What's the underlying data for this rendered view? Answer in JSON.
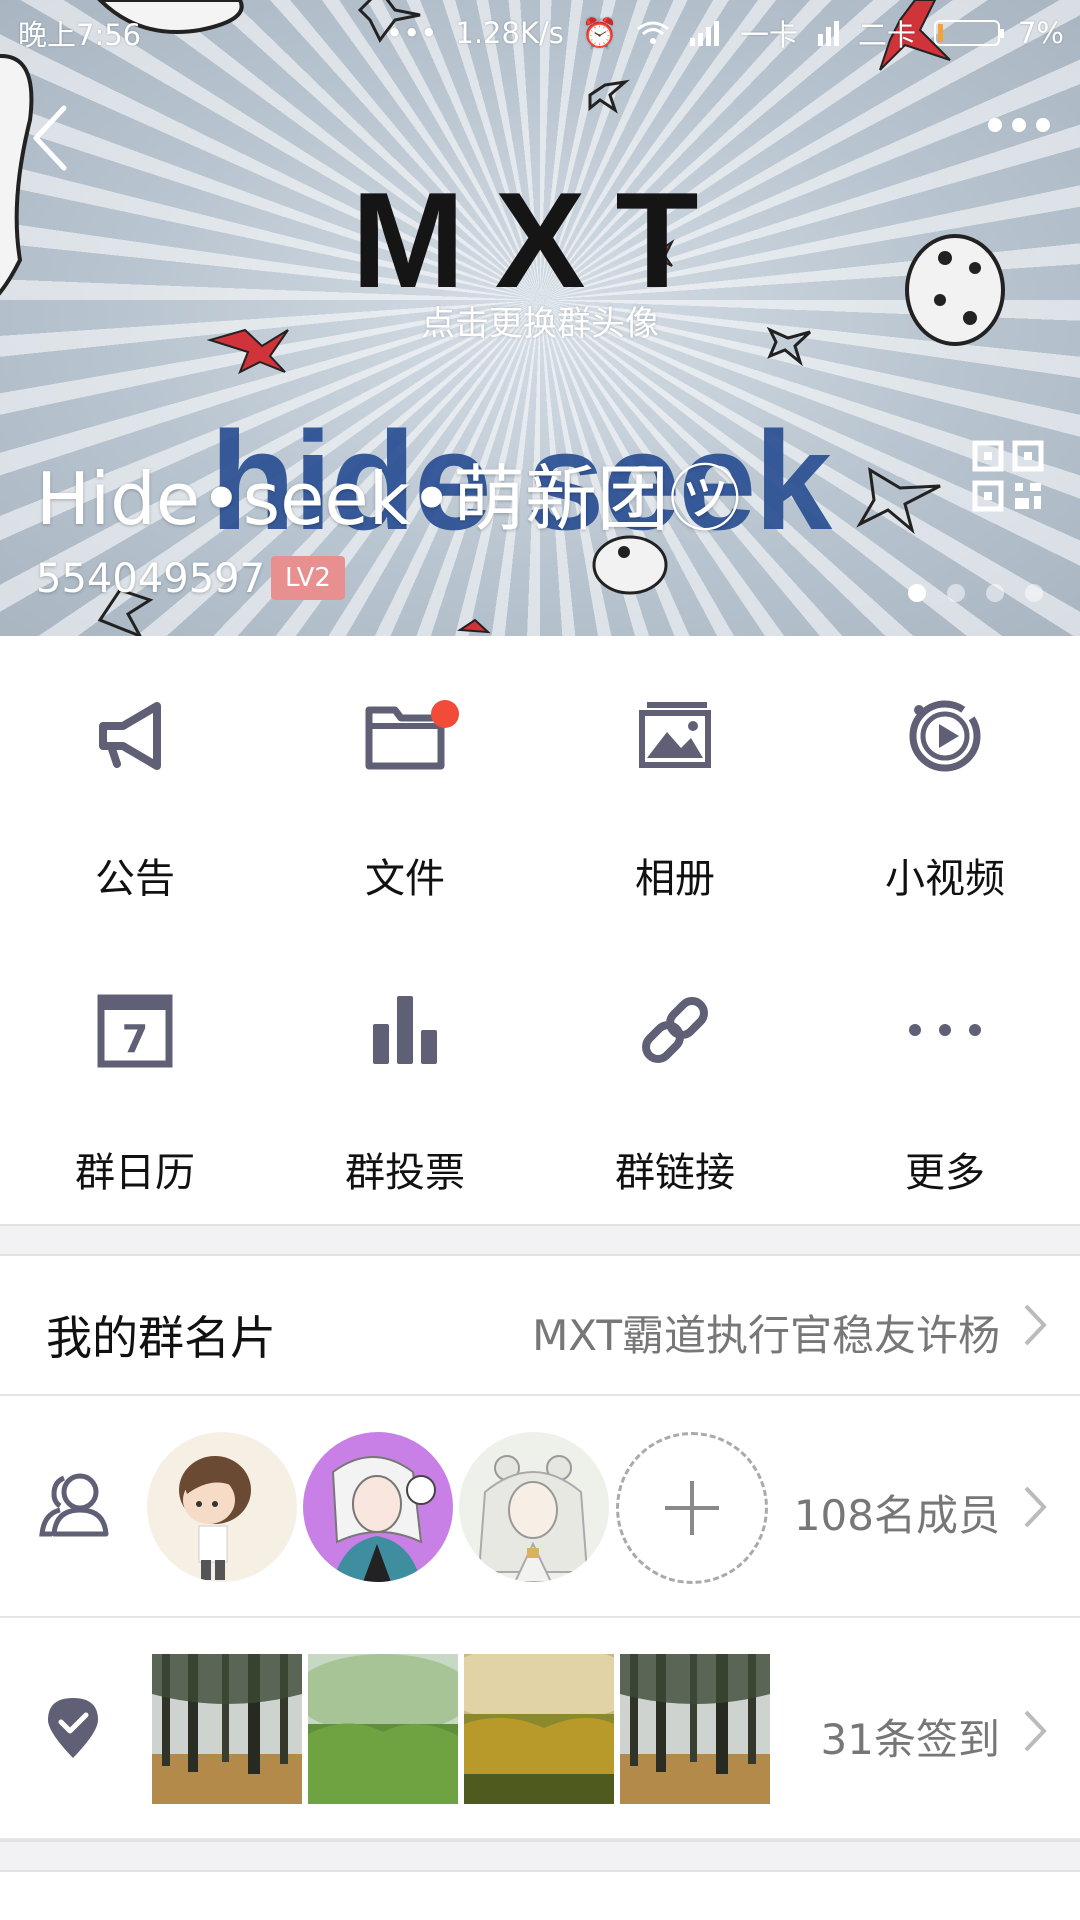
{
  "status_bar": {
    "time": "晚上7:56",
    "speed": "1.28K/s",
    "sim1": "一卡",
    "sim2": "二卡",
    "battery": "7%"
  },
  "hero": {
    "logo_text": "MXT",
    "avatar_hint": "点击更换群头像",
    "background_word": "hide seek",
    "group_name": "Hide•seek•萌新团㋡",
    "group_id": "554049597",
    "level": "LV2",
    "pager": {
      "count": 4,
      "active": 0
    }
  },
  "functions": [
    {
      "label": "公告",
      "icon": "megaphone-icon"
    },
    {
      "label": "文件",
      "icon": "folder-icon",
      "badge": true
    },
    {
      "label": "相册",
      "icon": "photo-album-icon"
    },
    {
      "label": "小视频",
      "icon": "video-play-icon"
    },
    {
      "label": "群日历",
      "icon": "calendar-icon",
      "calendar_day": "7"
    },
    {
      "label": "群投票",
      "icon": "bar-chart-icon"
    },
    {
      "label": "群链接",
      "icon": "link-icon"
    },
    {
      "label": "更多",
      "icon": "more-dots-icon"
    }
  ],
  "card": {
    "title": "我的群名片",
    "value": "MXT霸道执行官稳友许杨"
  },
  "members": {
    "count_text": "108名成员"
  },
  "checkin": {
    "count_text": "31条签到"
  },
  "colors": {
    "icon": "#5f6075",
    "badge_red": "#f24b3a",
    "level_badge": "#e88f8f",
    "hero_word": "#2a4f93"
  }
}
